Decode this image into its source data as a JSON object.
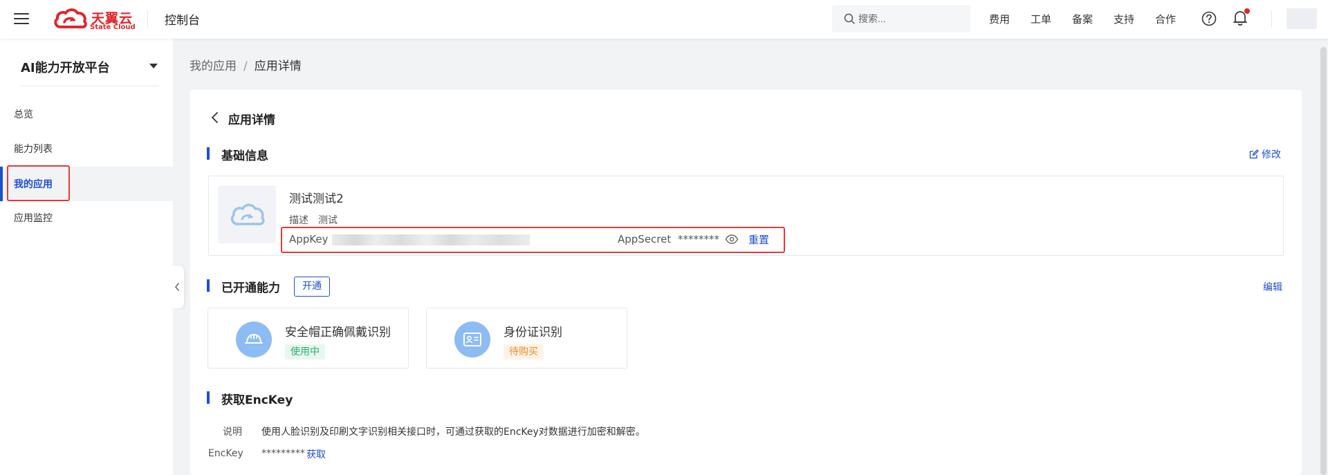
{
  "header": {
    "brand_cn": "天翼云",
    "brand_en": "State Cloud",
    "console_title": "控制台",
    "search_placeholder": "搜索...",
    "nav": [
      "费用",
      "工单",
      "备案",
      "支持",
      "合作"
    ],
    "help_icon": "question-circle-icon",
    "bell_icon": "bell-icon",
    "accent_color": "#e0262b"
  },
  "sidebar": {
    "title": "AI能力开放平台",
    "items": [
      {
        "label": "总览",
        "active": false
      },
      {
        "label": "能力列表",
        "active": false
      },
      {
        "label": "我的应用",
        "active": true
      },
      {
        "label": "应用监控",
        "active": false
      }
    ],
    "active_color": "#1e4fd1"
  },
  "breadcrumb": {
    "parent": "我的应用",
    "separator": "/",
    "current": "应用详情"
  },
  "detail": {
    "title": "应用详情",
    "basic": {
      "section_title": "基础信息",
      "edit_label": "修改",
      "app_name": "测试测试2",
      "desc_label": "描述",
      "desc_value": "测试",
      "appkey_label": "AppKey",
      "appsecret_label": "AppSecret",
      "appsecret_value": "********",
      "reset_label": "重置"
    },
    "capabilities": {
      "section_title": "已开通能力",
      "open_label": "开通",
      "edit_label": "编辑",
      "items": [
        {
          "name": "安全帽正确佩戴识别",
          "status": "使用中",
          "status_color": "#22b06a"
        },
        {
          "name": "身份证识别",
          "status": "待购买",
          "status_color": "#f08a24"
        }
      ]
    },
    "enckey": {
      "section_title": "获取EncKey",
      "note_label": "说明",
      "note_text": "使用人脸识别及印刷文字识别相关接口时，可通过获取的EncKey对数据进行加密和解密。",
      "enckey_label": "EncKey",
      "enckey_value": "*********",
      "fetch_label": "获取"
    }
  }
}
